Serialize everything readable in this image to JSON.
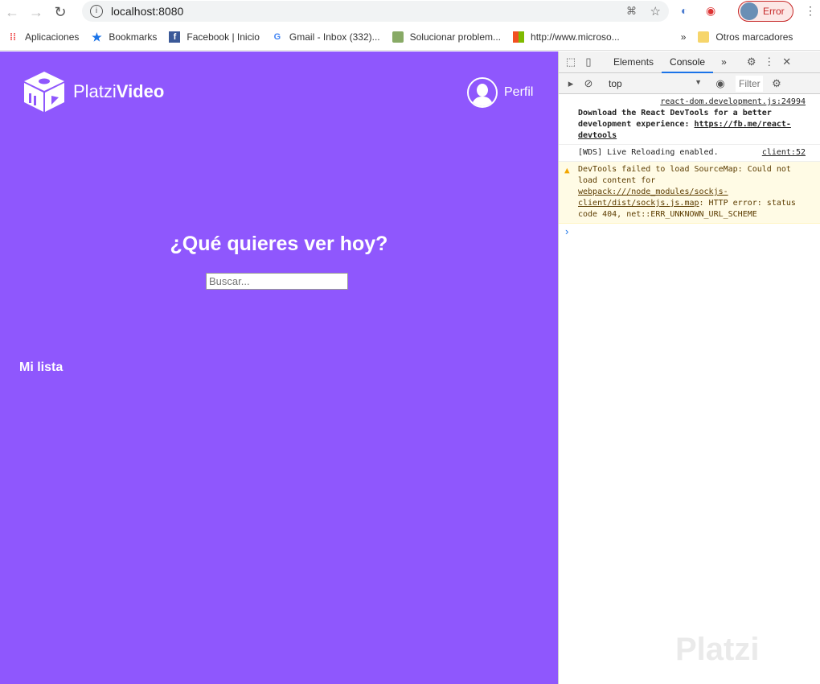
{
  "browser": {
    "url": "localhost:8080",
    "error_label": "Error",
    "bookmarks": [
      {
        "label": "Aplicaciones",
        "icon": "apps-grid-icon"
      },
      {
        "label": "Bookmarks",
        "icon": "star-icon"
      },
      {
        "label": "Facebook | Inicio",
        "icon": "facebook-icon"
      },
      {
        "label": "Gmail - Inbox (332)...",
        "icon": "google-icon"
      },
      {
        "label": "Solucionar problem...",
        "icon": "troubleshoot-icon"
      },
      {
        "label": "http://www.microso...",
        "icon": "microsoft-icon"
      }
    ],
    "overflow": "»",
    "other_bookmarks": "Otros marcadores"
  },
  "app": {
    "logo_light": "Platzi",
    "logo_bold": "Video",
    "profile_label": "Perfil",
    "hero_title": "¿Qué quieres ver hoy?",
    "search_placeholder": "Buscar...",
    "section_title": "Mi lista",
    "brand_color": "#8f57fd"
  },
  "devtools": {
    "tabs": [
      "Elements",
      "Console"
    ],
    "more": "»",
    "context": "top",
    "filter_placeholder": "Filter",
    "logs": [
      {
        "source": "react-dom.development.js:24994",
        "text": "Download the React DevTools for a better development experience: ",
        "link": "https://fb.me/react-devtools"
      },
      {
        "text": "[WDS] Live Reloading enabled.",
        "source": "client:52"
      },
      {
        "level": "warning",
        "text1": "DevTools failed to load SourceMap: Could not load content for ",
        "link": "webpack:///node_modules/sockjs-client/dist/sockjs.js.map",
        "text2": ": HTTP error: status code 404, net::ERR_UNKNOWN_URL_SCHEME"
      }
    ]
  },
  "watermark": "Platzi"
}
